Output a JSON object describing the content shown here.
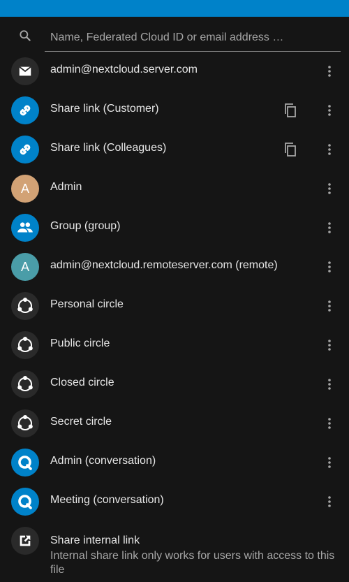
{
  "search": {
    "placeholder": "Name, Federated Cloud ID or email address …"
  },
  "shares": [
    {
      "label": "admin@nextcloud.server.com",
      "avatar": "email-icon"
    },
    {
      "label": "Share link (Customer)",
      "avatar": "link-icon"
    },
    {
      "label": "Share link (Colleagues)",
      "avatar": "link-icon"
    },
    {
      "label": "Admin",
      "avatar_letter": "A"
    },
    {
      "label": "Group (group)",
      "avatar": "group-icon"
    },
    {
      "label": "admin@nextcloud.remoteserver.com (remote)",
      "avatar_letter": "A"
    },
    {
      "label": "Personal circle",
      "avatar": "circle-icon"
    },
    {
      "label": "Public circle",
      "avatar": "circle-icon"
    },
    {
      "label": "Closed circle",
      "avatar": "circle-icon"
    },
    {
      "label": "Secret circle",
      "avatar": "circle-icon"
    },
    {
      "label": "Admin (conversation)",
      "avatar": "talk-icon"
    },
    {
      "label": "Meeting (conversation)",
      "avatar": "talk-icon"
    }
  ],
  "internal_link": {
    "title": "Share internal link",
    "subtitle": "Internal share link only works for users with access to this file"
  },
  "colors": {
    "accent": "#0082c9",
    "background": "#151515",
    "avatar_admin": "#d2a275",
    "avatar_remote": "#4a9da8"
  }
}
